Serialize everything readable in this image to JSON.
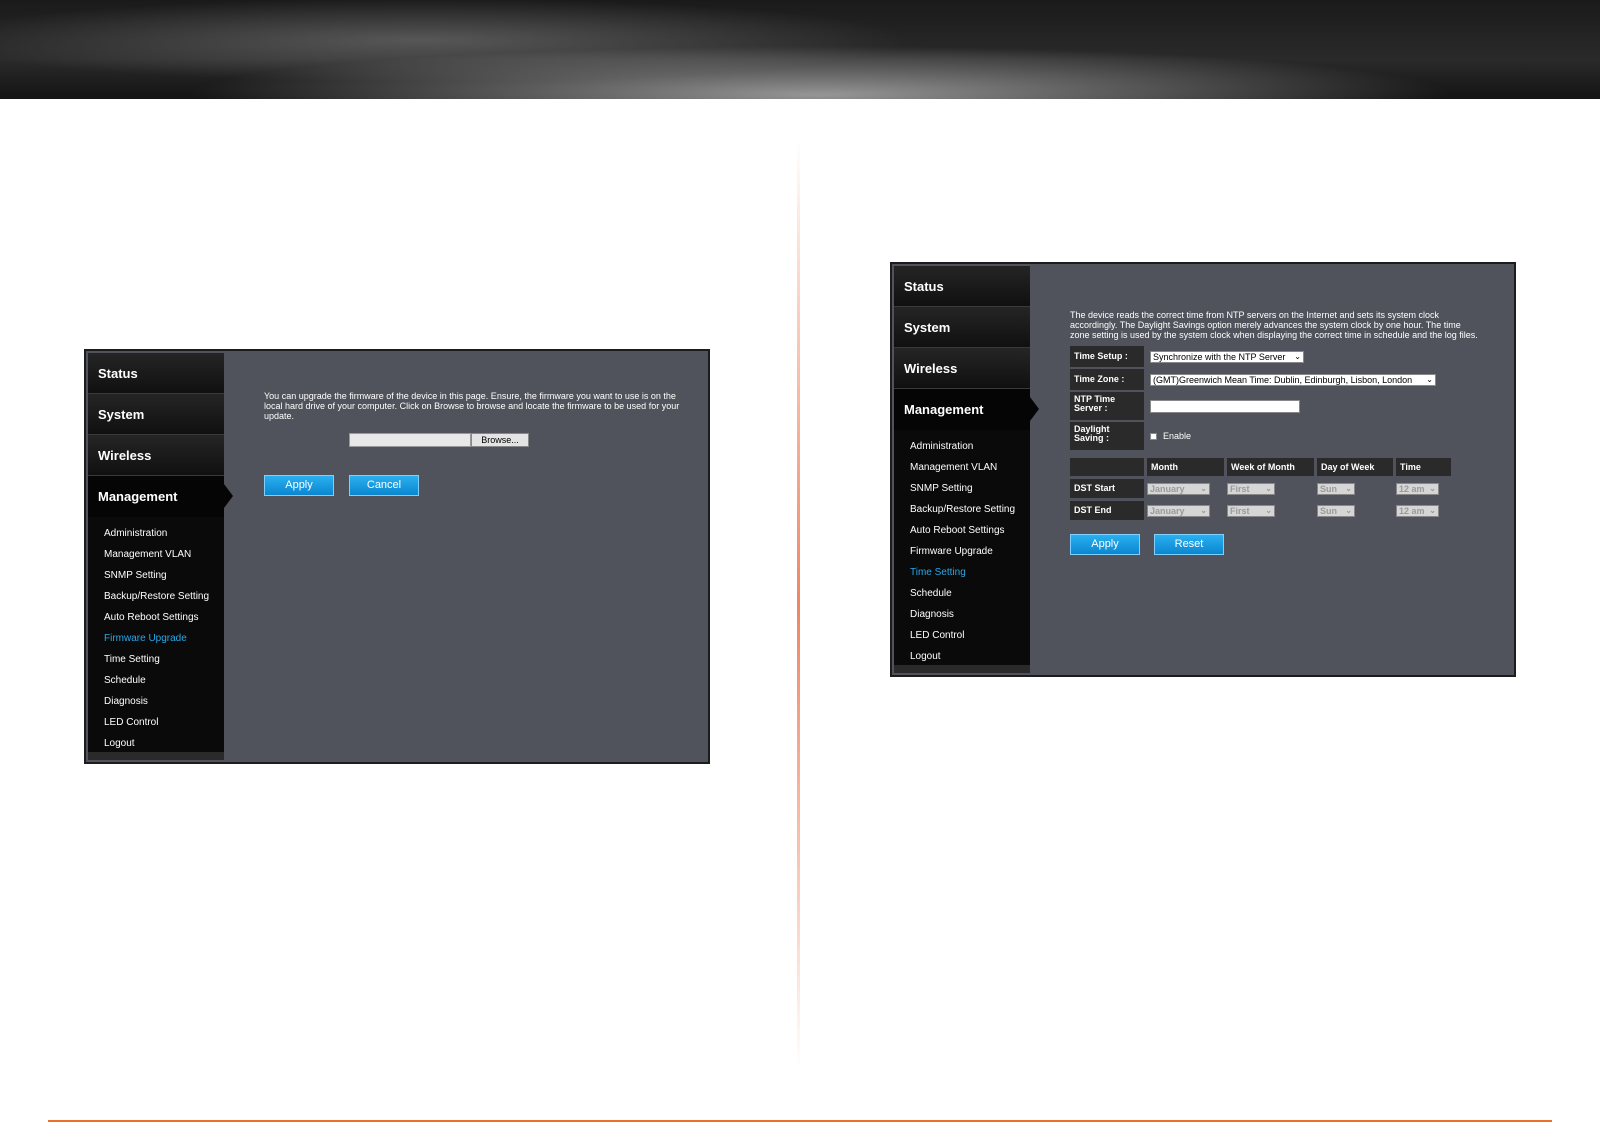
{
  "left_panel": {
    "nav": {
      "status": "Status",
      "system": "System",
      "wireless": "Wireless",
      "management": "Management",
      "submenu": [
        "Administration",
        "Management VLAN",
        "SNMP Setting",
        "Backup/Restore Setting",
        "Auto Reboot Settings",
        "Firmware Upgrade",
        "Time Setting",
        "Schedule",
        "Diagnosis",
        "LED Control",
        "Logout"
      ],
      "active": "Firmware Upgrade"
    },
    "description": "You can upgrade the firmware of the device in this page. Ensure, the firmware you want to use is on the local hard drive of your computer. Click on Browse to browse and locate the firmware to be used for your update.",
    "browse_label": "Browse...",
    "apply_label": "Apply",
    "cancel_label": "Cancel"
  },
  "right_panel": {
    "nav": {
      "status": "Status",
      "system": "System",
      "wireless": "Wireless",
      "management": "Management",
      "submenu": [
        "Administration",
        "Management VLAN",
        "SNMP Setting",
        "Backup/Restore Setting",
        "Auto Reboot Settings",
        "Firmware Upgrade",
        "Time Setting",
        "Schedule",
        "Diagnosis",
        "LED Control",
        "Logout"
      ],
      "active": "Time Setting"
    },
    "description": "The device reads the correct time from NTP servers on the Internet and sets its system clock accordingly. The Daylight Savings option merely advances the system clock by one hour. The time zone setting is used by the system clock when displaying the correct time in schedule and the log files.",
    "time_setup_label": "Time Setup :",
    "time_setup_value": "Synchronize with the NTP Server",
    "time_zone_label": "Time Zone :",
    "time_zone_value": "(GMT)Greenwich Mean Time: Dublin, Edinburgh, Lisbon, London",
    "ntp_label": "NTP Time Server :",
    "ntp_value": "",
    "daylight_label": "Daylight Saving :",
    "daylight_enable_label": "Enable",
    "daylight_enabled": false,
    "dst_headers": [
      "",
      "Month",
      "Week of Month",
      "Day of Week",
      "Time"
    ],
    "dst_rows": [
      {
        "label": "DST Start",
        "month": "January",
        "week": "First",
        "day": "Sun",
        "time": "12 am"
      },
      {
        "label": "DST End",
        "month": "January",
        "week": "First",
        "day": "Sun",
        "time": "12 am"
      }
    ],
    "apply_label": "Apply",
    "reset_label": "Reset"
  },
  "colors": {
    "panel_bg": "#50535b",
    "nav_bg": "#0a0a0a",
    "active_link": "#2aa7e8",
    "button": "#0a86d0",
    "accent_rule": "#e8722a"
  }
}
